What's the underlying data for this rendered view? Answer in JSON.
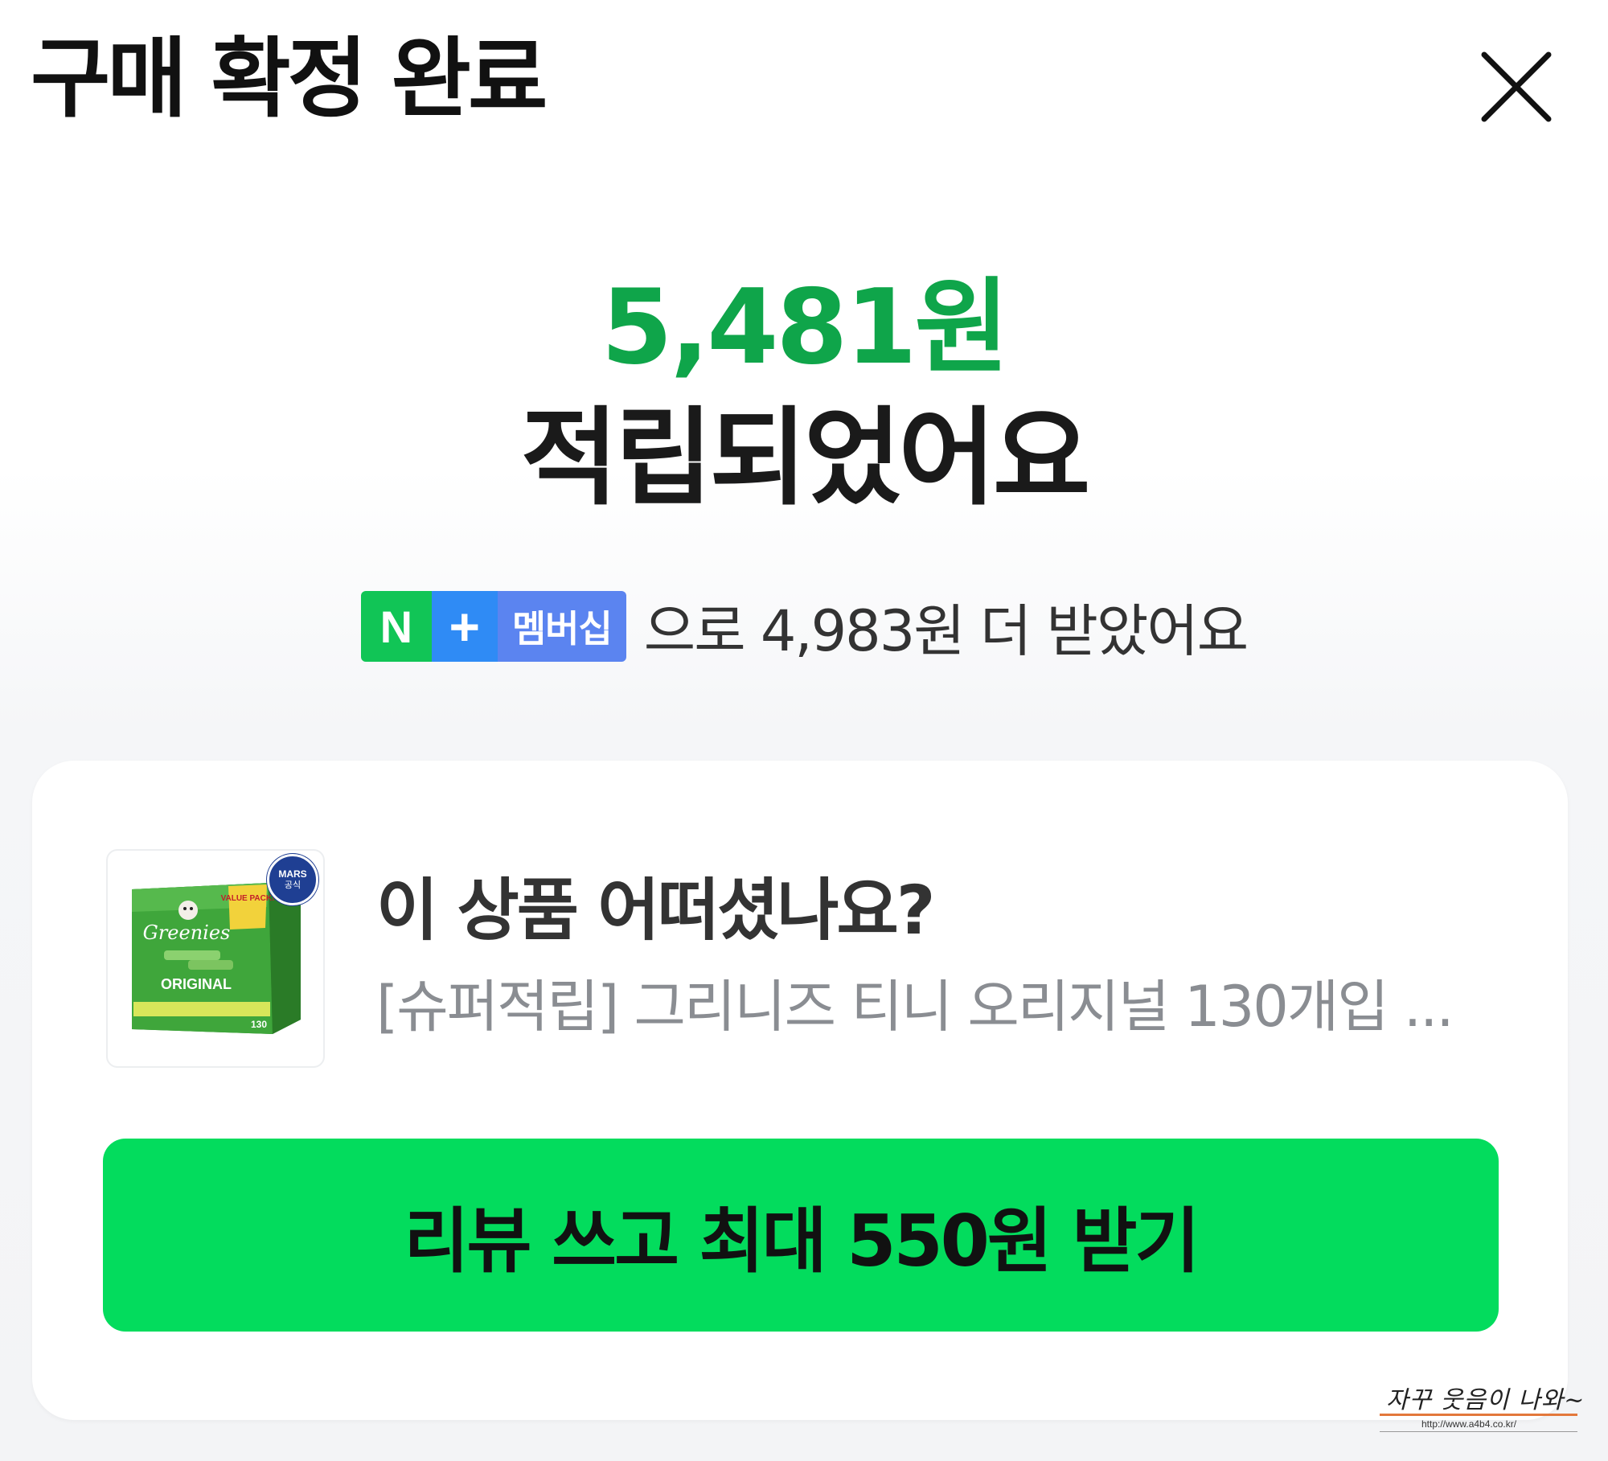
{
  "header": {
    "title": "구매 확정 완료",
    "close_icon": "close-icon"
  },
  "reward": {
    "amount": "5,481원",
    "message": "적립되었어요"
  },
  "membership": {
    "badge_n": "N",
    "badge_plus": "+",
    "badge_label": "멤버십",
    "text": "으로 4,983원 더 받았어요",
    "colors": {
      "n": "#11c556",
      "plus": "#2f8bf5",
      "label": "#5b84f0"
    }
  },
  "review_card": {
    "question": "이 상품 어떠셨나요?",
    "product_name": "[슈퍼적립] 그리니즈 티니 오리지널 130개입 ...",
    "thumbnail": {
      "mars_label": "MARS",
      "official_label": "공식",
      "brand": "Greenies",
      "pack_tag": "VALUE PACK!",
      "variant": "ORIGINAL",
      "count": "130"
    },
    "button_label": "리뷰 쓰고 최대 550원 받기"
  },
  "watermark": {
    "text": "자꾸 웃음이 나와~",
    "url": "http://www.a4b4.co.kr/"
  },
  "colors": {
    "accent_green": "#0fa54a",
    "button_green": "#03dc5d"
  }
}
